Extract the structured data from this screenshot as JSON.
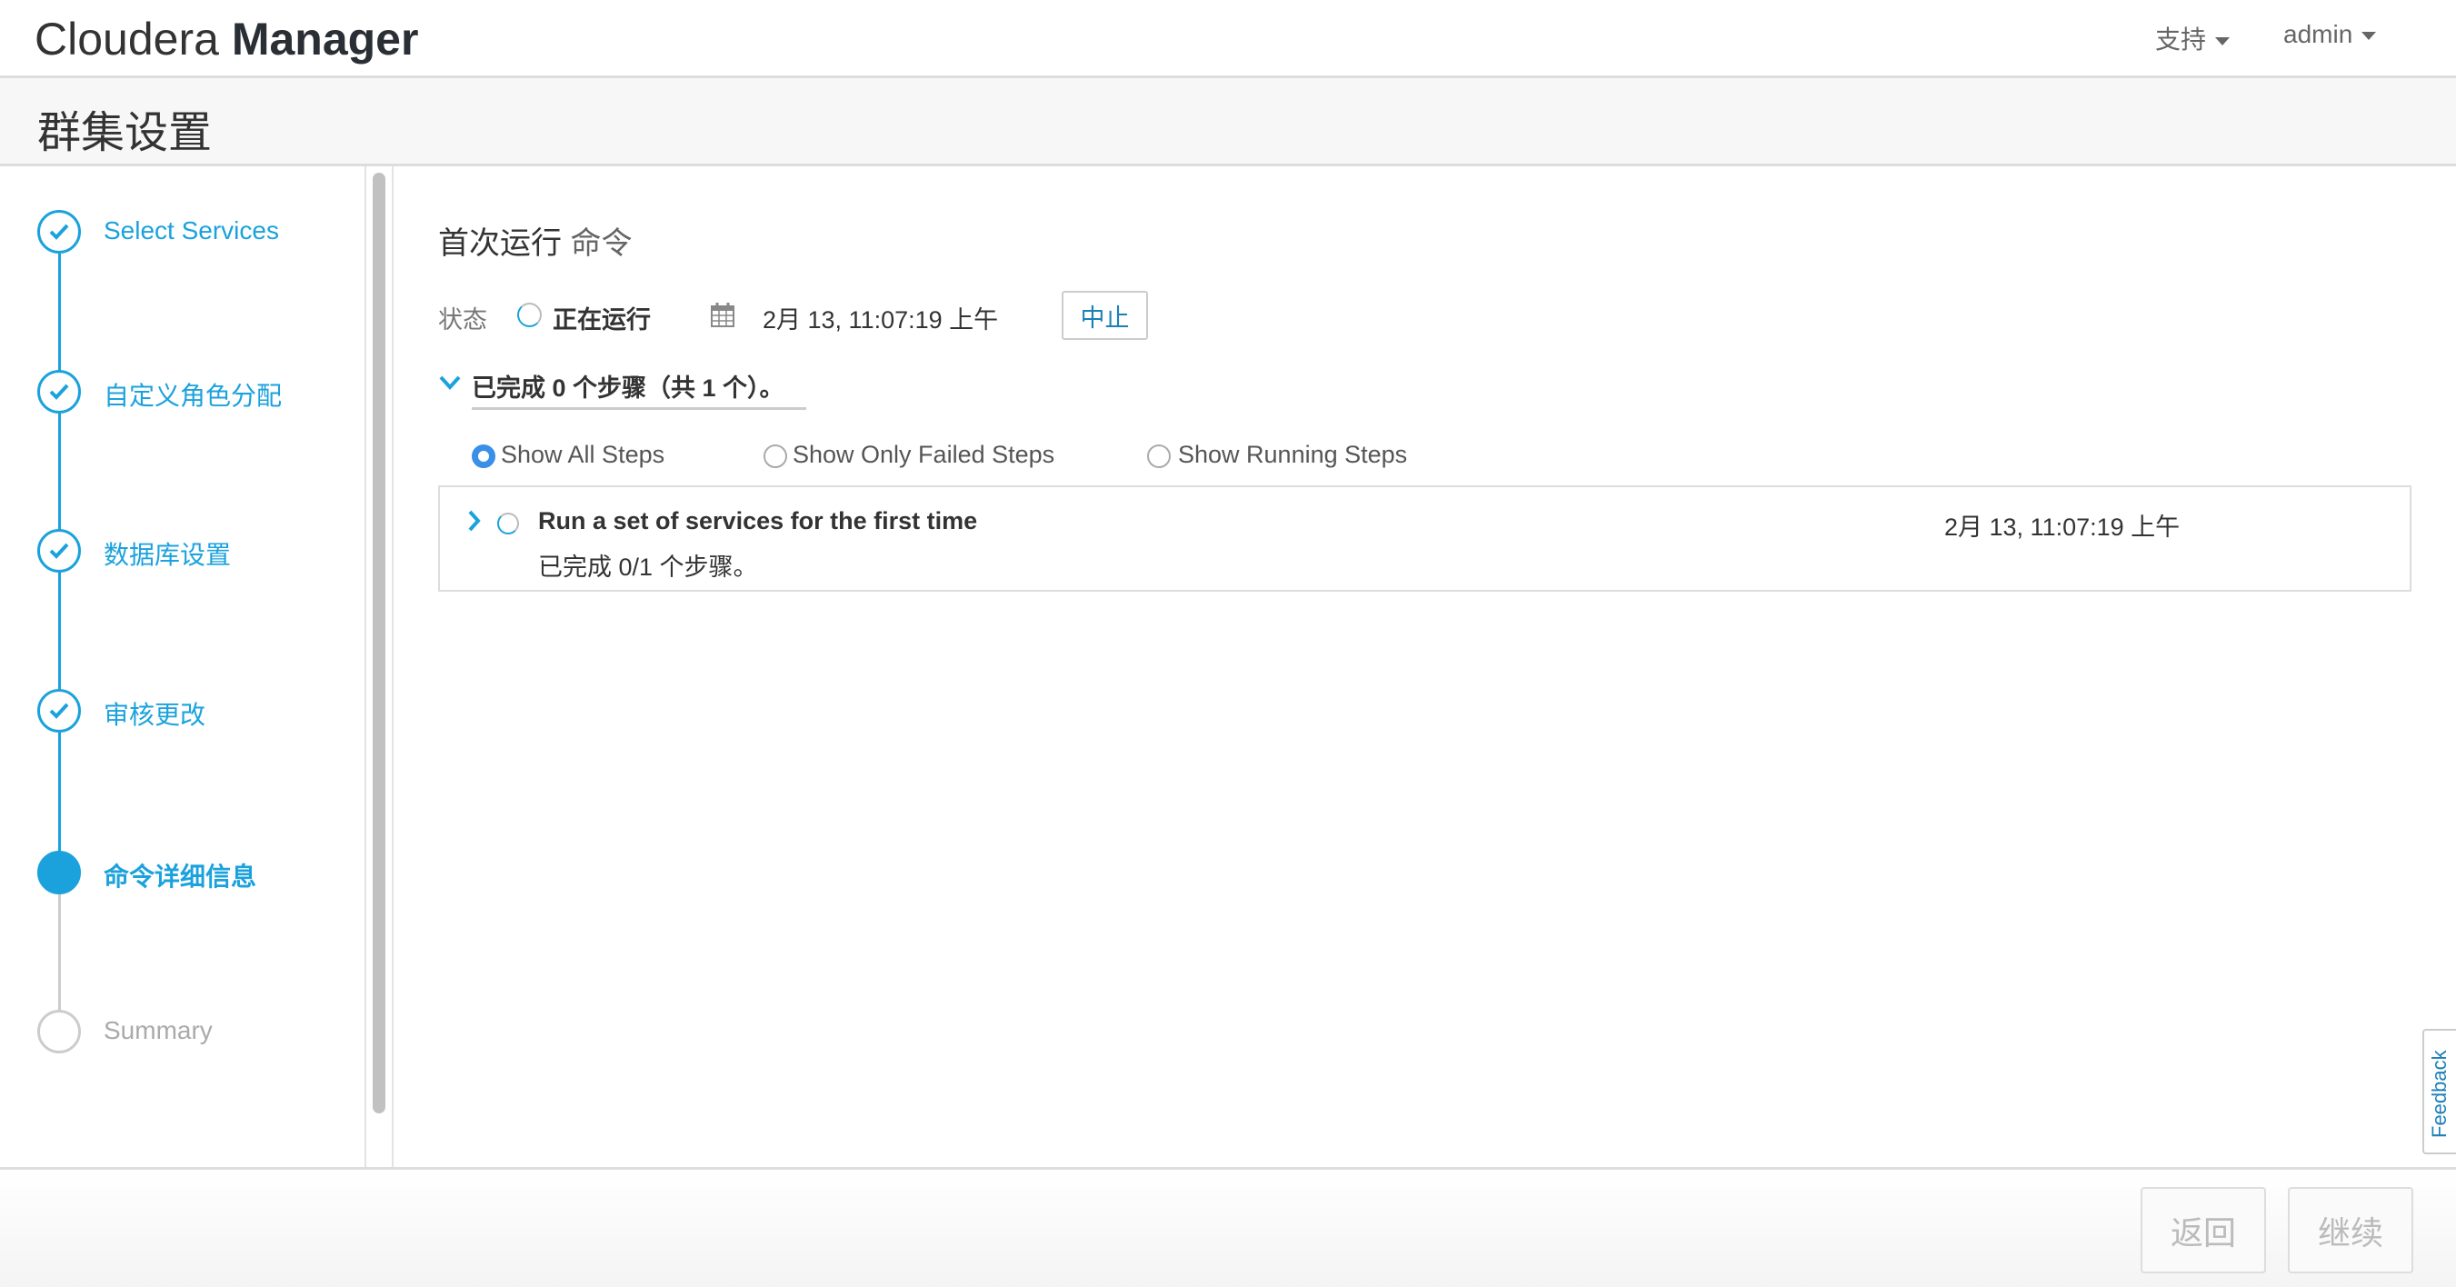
{
  "header": {
    "logo_light": "Cloudera",
    "logo_bold": "Manager",
    "menu_support": "支持",
    "menu_user": "admin"
  },
  "page": {
    "title": "群集设置"
  },
  "wizard": {
    "steps": [
      {
        "label": "Select Services",
        "state": "done"
      },
      {
        "label": "自定义角色分配",
        "state": "done"
      },
      {
        "label": "数据库设置",
        "state": "done"
      },
      {
        "label": "审核更改",
        "state": "done"
      },
      {
        "label": "命令详细信息",
        "state": "active"
      },
      {
        "label": "Summary",
        "state": "pending"
      }
    ]
  },
  "command": {
    "title": "首次运行",
    "title_suffix": "命令",
    "status_label": "状态",
    "status_value": "正在运行",
    "start_time": "2月 13, 11:07:19 上午",
    "abort_label": "中止",
    "progress_summary": "已完成 0 个步骤（共 1 个）。",
    "filters": [
      {
        "label": "Show All Steps",
        "selected": true
      },
      {
        "label": "Show Only Failed Steps",
        "selected": false
      },
      {
        "label": "Show Running Steps",
        "selected": false
      }
    ],
    "steps": [
      {
        "title": "Run a set of services for the first time",
        "time": "2月 13, 11:07:19 上午",
        "detail": "已完成 0/1 个步骤。"
      }
    ]
  },
  "feedback_label": "Feedback",
  "footer": {
    "back_label": "返回",
    "continue_label": "继续"
  },
  "colors": {
    "accent": "#1ba2dd",
    "radio": "#3a8fe6"
  }
}
